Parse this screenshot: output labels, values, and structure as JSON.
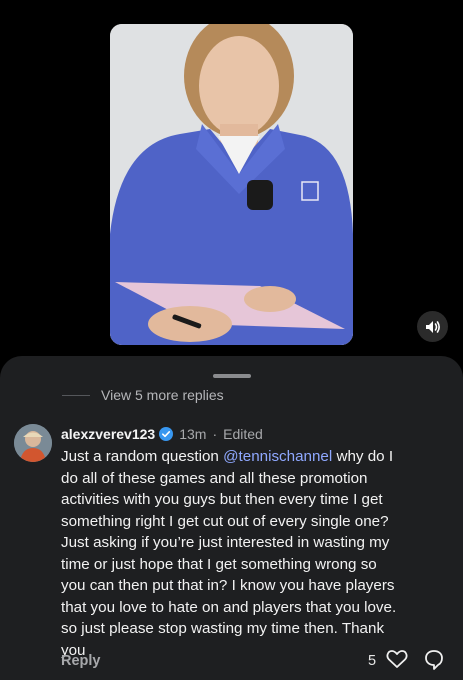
{
  "video": {
    "mute_icon": "speaker-icon"
  },
  "replies": {
    "view_more_label": "View 5 more replies"
  },
  "comment": {
    "username": "alexzverev123",
    "time": "13m",
    "separator": "·",
    "edited": "Edited",
    "text_before_mention": "Just a random question ",
    "mention": "@tennischannel",
    "text_after_mention": " why do I\ndo all of these games and all these promotion\nactivities with you guys but then every time I get\nsomething right I get cut out of every single one?\nJust asking if you’re just interested in wasting my\ntime or just hope that I get something wrong so\nyou can then put that in? I know you have players\nthat you love to hate on and players that you love.\nso just please stop wasting my time then. Thank\nyou",
    "reply_label": "Reply",
    "like_count": "5"
  },
  "colors": {
    "mention": "#8fa8ff",
    "verified": "#3897f0",
    "sheet_bg": "#1e1f21"
  }
}
